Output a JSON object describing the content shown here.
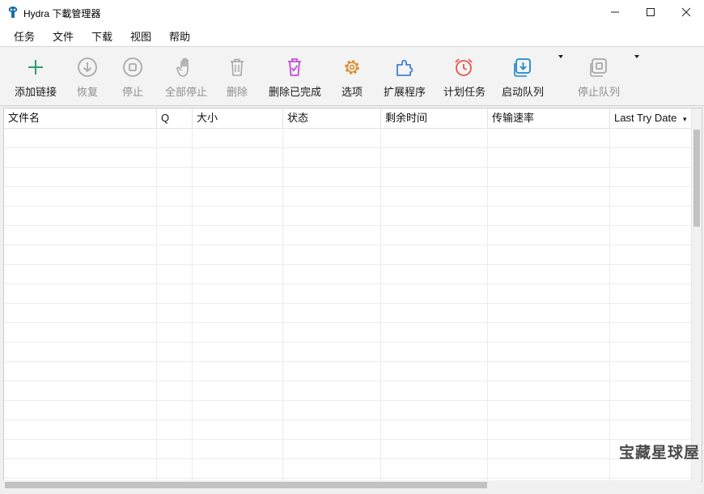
{
  "window": {
    "title": "Hydra 下載管理器"
  },
  "menu": [
    "任务",
    "文件",
    "下载",
    "视图",
    "帮助"
  ],
  "toolbar": {
    "add": "添加链接",
    "resume": "恢复",
    "stop": "停止",
    "stop_all": "全部停止",
    "delete": "删除",
    "delete_completed": "删除已完成",
    "options": "选项",
    "extensions": "扩展程序",
    "scheduler": "计划任务",
    "start_queue": "启动队列",
    "stop_queue": "停止队列"
  },
  "table": {
    "columns": [
      "文件名",
      "Q",
      "大小",
      "状态",
      "剩余时间",
      "传输速率",
      "Last Try Date"
    ],
    "sort_indicator": "▾",
    "rows": []
  },
  "watermark": "宝藏星球屋",
  "colors": {
    "add": "#2e9e6e",
    "disabled": "#a8a8a8",
    "delete_completed": "#c04fd8",
    "options": "#d98c2b",
    "extensions": "#3f7fd6",
    "scheduler": "#e2574c",
    "queue": "#1f88c9"
  }
}
